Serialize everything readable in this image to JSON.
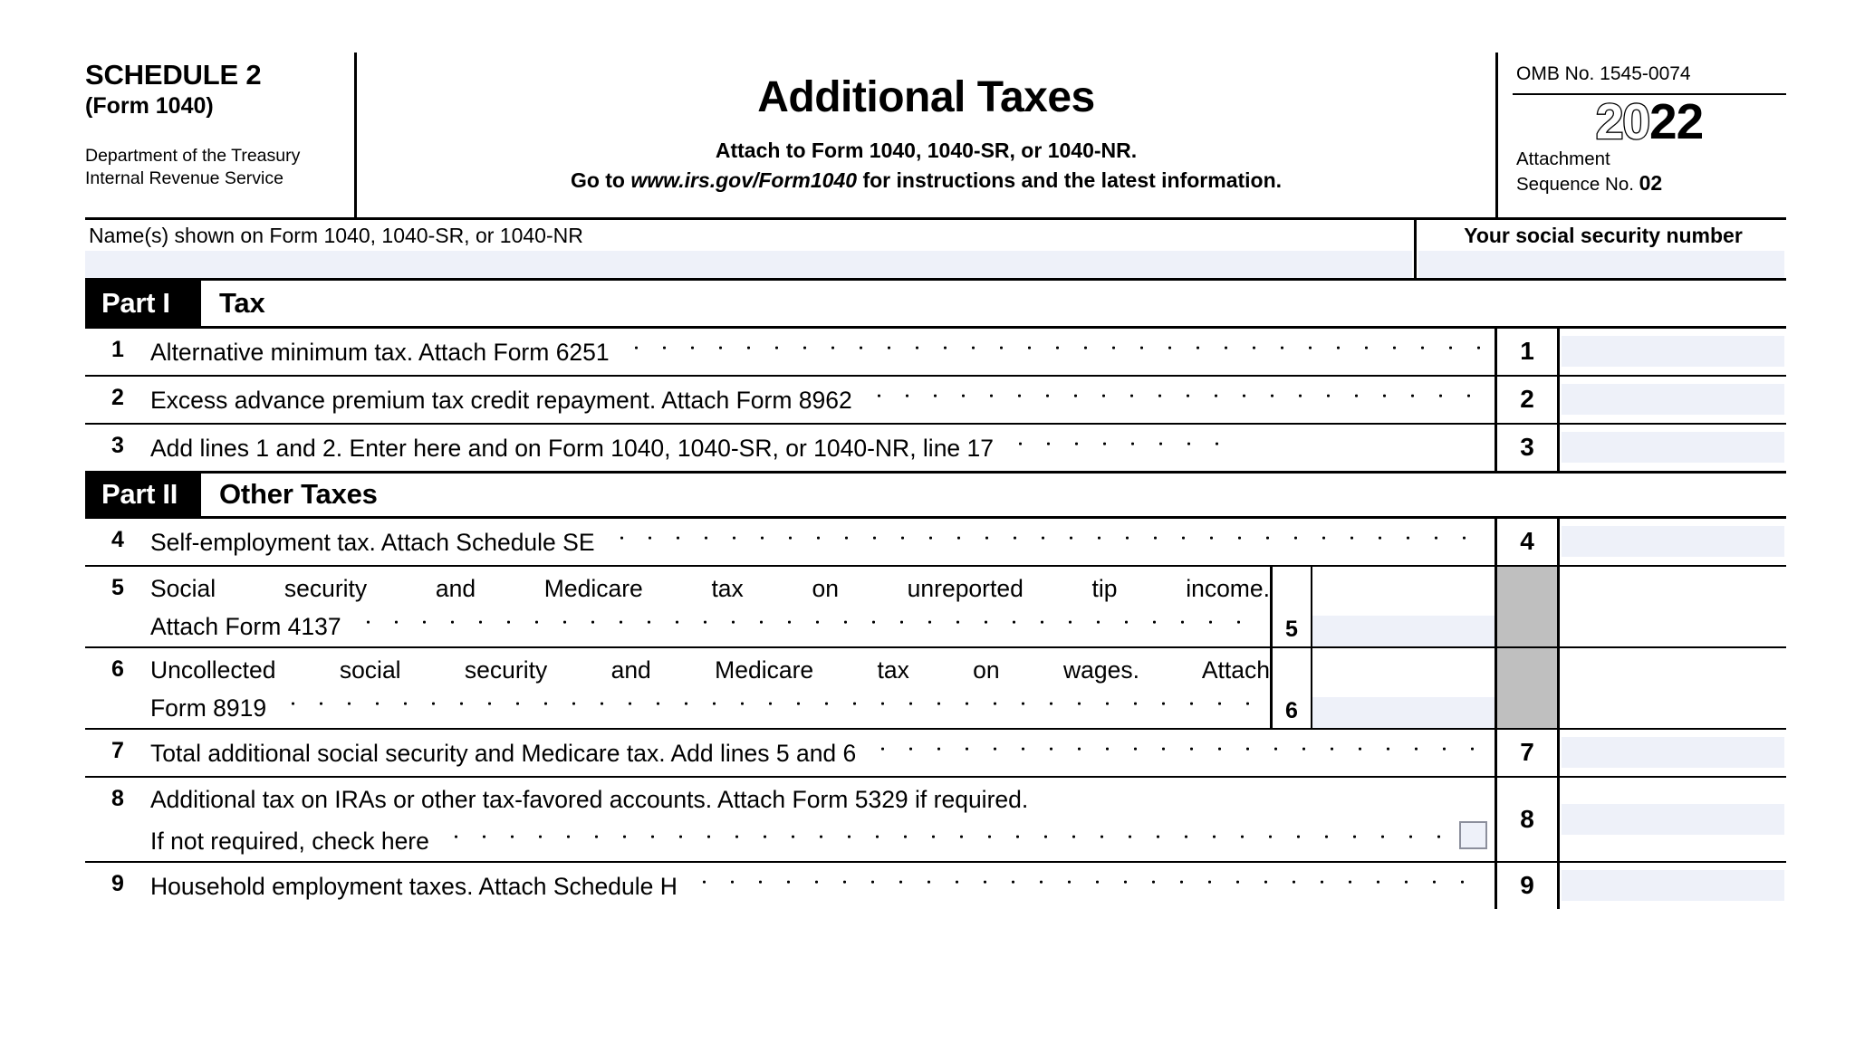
{
  "form": {
    "schedule_title": "SCHEDULE 2",
    "schedule_subtitle": "(Form 1040)",
    "department_line1": "Department of the Treasury",
    "department_line2": "Internal Revenue Service",
    "main_title": "Additional Taxes",
    "attach_line": "Attach to Form 1040, 1040-SR, or 1040-NR.",
    "goto_prefix": "Go to ",
    "goto_url": "www.irs.gov/Form1040",
    "goto_suffix": " for instructions and the latest information.",
    "omb": "OMB No. 1545-0074",
    "year_hollow": "20",
    "year_solid": "22",
    "attachment_label": "Attachment",
    "sequence_label": "Sequence No.",
    "sequence_number": "02",
    "name_label": "Name(s) shown on Form 1040, 1040-SR, or 1040-NR",
    "ssn_label": "Your social security number"
  },
  "parts": [
    {
      "tag": "Part I",
      "name": "Tax"
    },
    {
      "tag": "Part II",
      "name": "Other Taxes"
    }
  ],
  "lines": [
    {
      "num": "1",
      "text": "Alternative minimum tax. Attach Form 6251",
      "box_num": "1"
    },
    {
      "num": "2",
      "text": "Excess advance premium tax credit repayment. Attach Form 8962",
      "box_num": "2"
    },
    {
      "num": "3",
      "text": "Add lines 1 and 2. Enter here and on Form 1040, 1040-SR, or 1040-NR, line 17",
      "box_num": "3"
    },
    {
      "num": "4",
      "text": "Self-employment tax. Attach Schedule SE",
      "box_num": "4"
    },
    {
      "num": "5",
      "text_line1": "Social security and Medicare tax on unreported tip income.",
      "text_line2": "Attach Form 4137",
      "sub_num": "5"
    },
    {
      "num": "6",
      "text_line1": "Uncollected social security and Medicare tax on wages. Attach",
      "text_line2": "Form 8919",
      "sub_num": "6"
    },
    {
      "num": "7",
      "text": "Total additional social security and Medicare tax. Add lines 5 and 6",
      "box_num": "7"
    },
    {
      "num": "8",
      "text_line1": "Additional tax on IRAs or other tax-favored accounts. Attach Form 5329 if required.",
      "text_line2": "If not required, check here",
      "box_num": "8",
      "checkbox": "unchecked"
    },
    {
      "num": "9",
      "text": "Household employment taxes. Attach Schedule H",
      "box_num": "9"
    }
  ],
  "colors": {
    "field_fill": "#eef1f9",
    "gray_block": "#bfbfbf",
    "rule": "#000000"
  }
}
